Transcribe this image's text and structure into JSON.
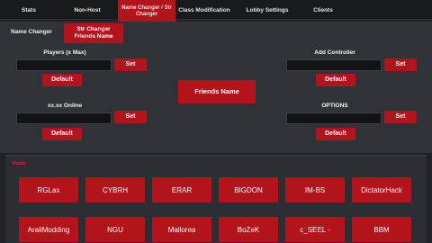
{
  "tabs": [
    {
      "label": "Stats"
    },
    {
      "label": "Non-Host"
    },
    {
      "label": "Name Changer / Str Changer"
    },
    {
      "label": "Class Modification"
    },
    {
      "label": "Lobby Settings"
    },
    {
      "label": "Clients"
    }
  ],
  "name_changer": {
    "section_label": "Name Changer",
    "str_changer_label": "Str Changer",
    "friends_names_label": "Friends Name"
  },
  "left_fields": [
    {
      "label": "Players (x Max)",
      "value": "",
      "set": "Set",
      "default": "Default"
    },
    {
      "label": "xx.xx Online",
      "value": "",
      "set": "Set",
      "default": "Default"
    }
  ],
  "right_fields": [
    {
      "label": "Add Controller",
      "value": "",
      "set": "Set",
      "default": "Default"
    },
    {
      "label": "OPTIONS",
      "value": "",
      "set": "Set",
      "default": "Default"
    }
  ],
  "center_button": "Friends Name",
  "hosts": {
    "title": "Hosts:",
    "row1": [
      "RGLax",
      "CYBRH",
      "ERAR",
      "BIGDON",
      "IM-BS",
      "DictatorHack"
    ],
    "row2": [
      "AraliModding",
      "NGU",
      "Mallorea",
      "BoZeK",
      "c_SEEL -",
      "BBM"
    ]
  },
  "colors": {
    "accent": "#b3141b",
    "panel": "#2f3338",
    "background": "#1f2226"
  }
}
